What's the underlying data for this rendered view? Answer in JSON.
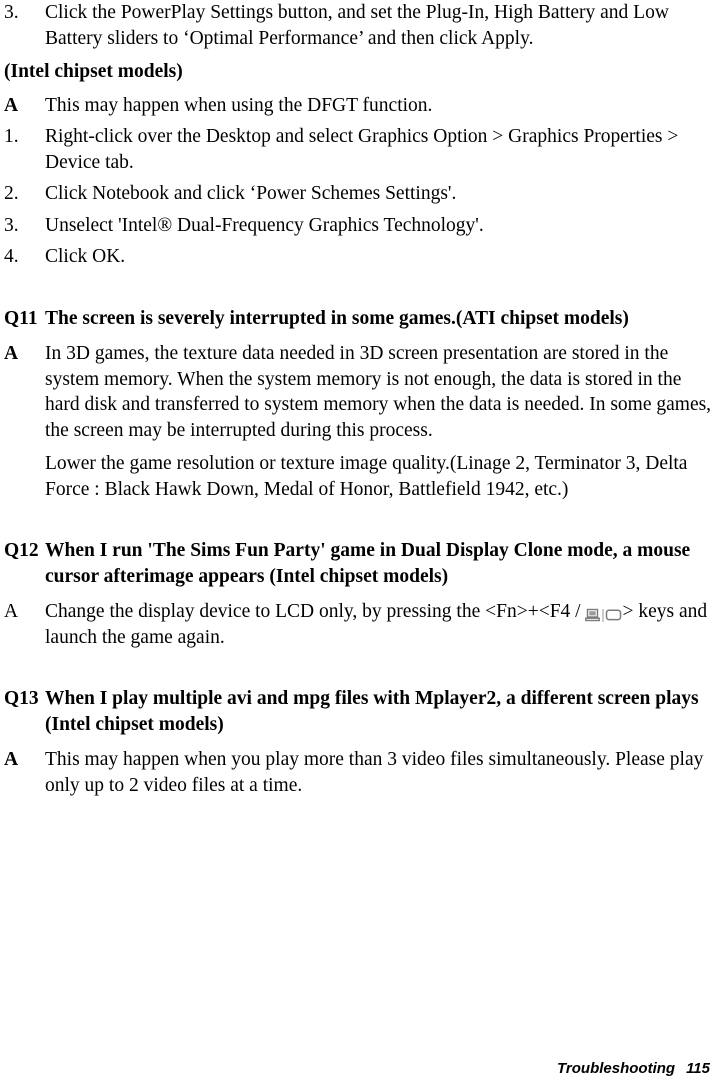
{
  "document": {
    "title": "Troubleshooting",
    "page_number": "115"
  },
  "blocks": {
    "step3": {
      "marker": "3.",
      "text": "Click the PowerPlay Settings button, and set the Plug-In, High Battery and Low Battery sliders to ‘Optimal Performance’ and then click Apply."
    },
    "intel_heading": {
      "text": "(Intel chipset models)"
    },
    "intel_answer": {
      "marker": "A",
      "text": "This may happen when using the DFGT function."
    },
    "intel_steps": [
      {
        "marker": "1.",
        "text": "Right-click over the Desktop and select Graphics Option > Graphics Properties > Device tab."
      },
      {
        "marker": "2.",
        "text": "Click Notebook and click ‘Power Schemes Settings'."
      },
      {
        "marker": "3.",
        "text": "Unselect 'Intel® Dual-Frequency Graphics Technology'."
      },
      {
        "marker": "4.",
        "text": "Click OK."
      }
    ],
    "q11": {
      "marker": "Q11",
      "question": "The screen is severely interrupted in some games.(ATI chipset models)",
      "answer_marker": "A",
      "answer_para1": "In 3D games, the texture data needed in 3D screen presentation are stored in the system memory. When the system memory is not enough, the data is stored in the hard disk and transferred to system memory when the data is needed. In some games, the screen may be interrupted during this process.",
      "answer_para2": "Lower the game resolution or texture image quality.(Linage 2, Terminator 3, Delta Force : Black Hawk Down, Medal of Honor, Battlefield 1942, etc.)"
    },
    "q12": {
      "marker": "Q12",
      "question": "When I run 'The Sims Fun Party' game in Dual Display Clone mode, a mouse cursor afterimage appears (Intel chipset models)",
      "answer_marker": "A",
      "answer_text_before_icon": "Change the display device to LCD only, by pressing the <Fn>+<F4 / ",
      "icon_lcd_name": "lcd-display-icon",
      "icon_separator": "|",
      "icon_crt_name": "crt-monitor-icon",
      "answer_text_after_icon": "> keys and launch the game again."
    },
    "q13": {
      "marker": "Q13",
      "question": "When I play multiple avi and mpg files with Mplayer2, a different screen plays (Intel chipset models)",
      "answer_marker": "A",
      "answer_text": "This may happen when you play more than 3 video files simultaneously. Please play only up to 2 video files at a time."
    }
  },
  "colors": {
    "text": "#000000",
    "background": "#ffffff",
    "icon_gray": "#7a7a7a"
  }
}
